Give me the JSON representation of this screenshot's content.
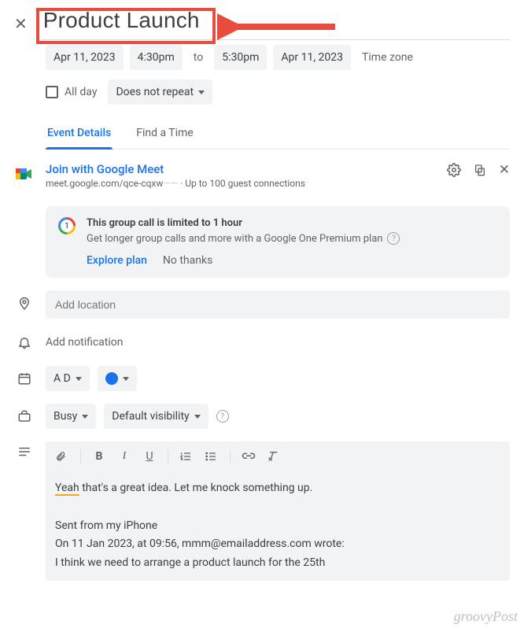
{
  "title": "Product Launch",
  "date_start": "Apr 11, 2023",
  "time_start": "4:30pm",
  "to_label": "to",
  "time_end": "5:30pm",
  "date_end": "Apr 11, 2023",
  "timezone_label": "Time zone",
  "allday_label": "All day",
  "repeat_label": "Does not repeat",
  "tabs": {
    "details": "Event Details",
    "findtime": "Find a Time"
  },
  "meet": {
    "join": "Join with Google Meet",
    "url_prefix": "meet.google.com/qce-cqxw",
    "guests": "Up to 100 guest connections"
  },
  "notice": {
    "title": "This group call is limited to 1 hour",
    "text": "Get longer group calls and more with a Google One Premium plan",
    "explore": "Explore plan",
    "nothanks": "No thanks"
  },
  "location_placeholder": "Add location",
  "notification_label": "Add notification",
  "calendar_initials": "A D",
  "busy_label": "Busy",
  "visibility_label": "Default visibility",
  "description": {
    "line1a": "Yeah",
    "line1b": " that's a great idea. Let me knock something up.",
    "sent": "Sent from my iPhone",
    "quote_header": "On 11 Jan 2023, at 09:56, mmm@emailaddress.com wrote:",
    "quote_body": "I think we need to arrange a product launch for the 25th"
  },
  "watermark": "groovyPost"
}
